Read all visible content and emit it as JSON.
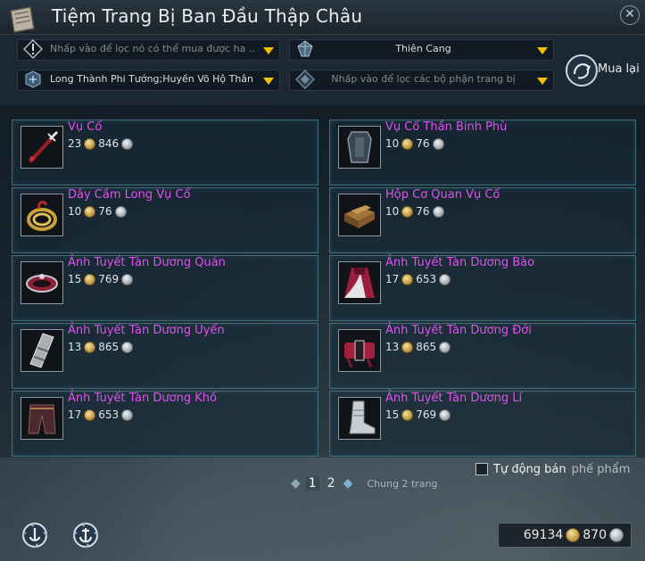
{
  "window": {
    "title": "Tiệm Trang Bị Ban Đầu Thập Châu",
    "close_symbol": "✕"
  },
  "filters": {
    "search_placeholder": "Nhấp vào để lọc nó có thể  mua được ha ..",
    "category_value": "Thiên Cang",
    "class_value": "Long Thành Phi Tướng;Huyền Võ Hộ Thân",
    "parts_placeholder": "Nhấp vào để lọc các bộ phận trang bị"
  },
  "buyback": {
    "label": "Mua lại"
  },
  "items": [
    {
      "name": "Vụ Cổ",
      "price_gold": "23",
      "price_silver": "846",
      "icon": "sword-icon"
    },
    {
      "name": "Vụ Cổ Thần Binh Phù",
      "price_gold": "10",
      "price_silver": "76",
      "icon": "talisman-icon"
    },
    {
      "name": "Dây Cầm Long Vụ Cổ",
      "price_gold": "10",
      "price_silver": "76",
      "icon": "coiled-rope-icon"
    },
    {
      "name": "Hộp Cơ Quan Vụ Cổ",
      "price_gold": "10",
      "price_silver": "76",
      "icon": "mechanism-box-icon"
    },
    {
      "name": "Ảnh Tuyết Tàn Dương Quán",
      "price_gold": "15",
      "price_silver": "769",
      "icon": "headband-icon"
    },
    {
      "name": "Ảnh Tuyết Tàn Dương Bào",
      "price_gold": "17",
      "price_silver": "653",
      "icon": "robe-icon"
    },
    {
      "name": "Ảnh Tuyết Tàn Dương Uyển",
      "price_gold": "13",
      "price_silver": "865",
      "icon": "bracer-icon"
    },
    {
      "name": "Ảnh Tuyết Tàn Dương Đới",
      "price_gold": "13",
      "price_silver": "865",
      "icon": "belt-icon"
    },
    {
      "name": "Ảnh Tuyết Tàn Dương Khố",
      "price_gold": "17",
      "price_silver": "653",
      "icon": "pants-icon"
    },
    {
      "name": "Ảnh Tuyết Tàn Dương Lí",
      "price_gold": "15",
      "price_silver": "769",
      "icon": "boots-icon"
    }
  ],
  "autosell": {
    "label": "Tự động bán",
    "suffix": "phế phẩm",
    "checked": false
  },
  "pagination": {
    "prev_symbol": "◆",
    "next_symbol": "◆",
    "pages": [
      "1",
      "2"
    ],
    "current": "1",
    "total_label": "Chung 2 trang"
  },
  "currency": {
    "gold": "69134",
    "silver": "870"
  },
  "colors": {
    "item_name": "#e052ee",
    "card_border": "#3d6e7c",
    "caret": "#f2c200"
  }
}
